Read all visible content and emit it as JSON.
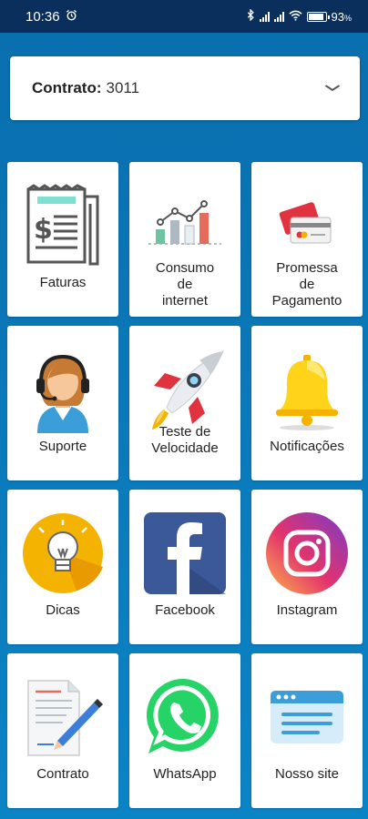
{
  "status_bar": {
    "time": "10:36",
    "battery_level": "93",
    "battery_unit": "%",
    "network": "4G"
  },
  "contract": {
    "label": "Contrato:",
    "value": "3011"
  },
  "tiles": [
    {
      "label": "Faturas",
      "icon": "invoice-icon"
    },
    {
      "label": "Consumo\nde\ninternet",
      "icon": "bar-chart-icon"
    },
    {
      "label": "Promessa\nde\nPagamento",
      "icon": "credit-cards-icon"
    },
    {
      "label": "Suporte",
      "icon": "support-agent-icon"
    },
    {
      "label": "Teste de\nVelocidade",
      "icon": "rocket-icon"
    },
    {
      "label": "Notificações",
      "icon": "bell-icon"
    },
    {
      "label": "Dicas",
      "icon": "lightbulb-icon"
    },
    {
      "label": "Facebook",
      "icon": "facebook-icon"
    },
    {
      "label": "Instagram",
      "icon": "instagram-icon"
    },
    {
      "label": "Contrato",
      "icon": "contract-document-icon"
    },
    {
      "label": "WhatsApp",
      "icon": "whatsapp-icon"
    },
    {
      "label": "Nosso site",
      "icon": "website-icon"
    }
  ],
  "colors": {
    "status_bar": "#0a2f5c",
    "background": "#0b7cc0",
    "tile": "#ffffff",
    "facebook": "#3b5998",
    "whatsapp": "#25d366"
  }
}
